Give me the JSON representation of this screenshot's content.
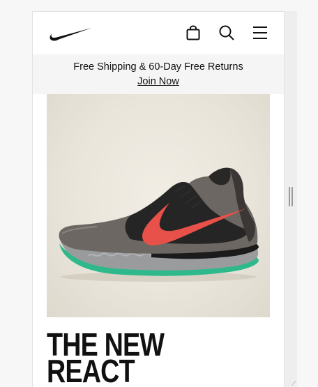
{
  "header": {
    "logo": "nike-swoosh-logo",
    "icons": [
      "shopping-bag-icon",
      "search-icon",
      "hamburger-menu-icon"
    ]
  },
  "promo": {
    "text": "Free Shipping & 60-Day Free Returns",
    "link": "Join Now"
  },
  "hero": {
    "image": "running-shoe-product-photo"
  },
  "headline": {
    "line1": "THE NEW",
    "line2": "REACT"
  },
  "colors": {
    "page_bg": "#ffffff",
    "promo_bg": "#f5f5f5",
    "text": "#111111",
    "accent_swoosh": "#e8504a",
    "accent_sole": "#2fb98a"
  }
}
